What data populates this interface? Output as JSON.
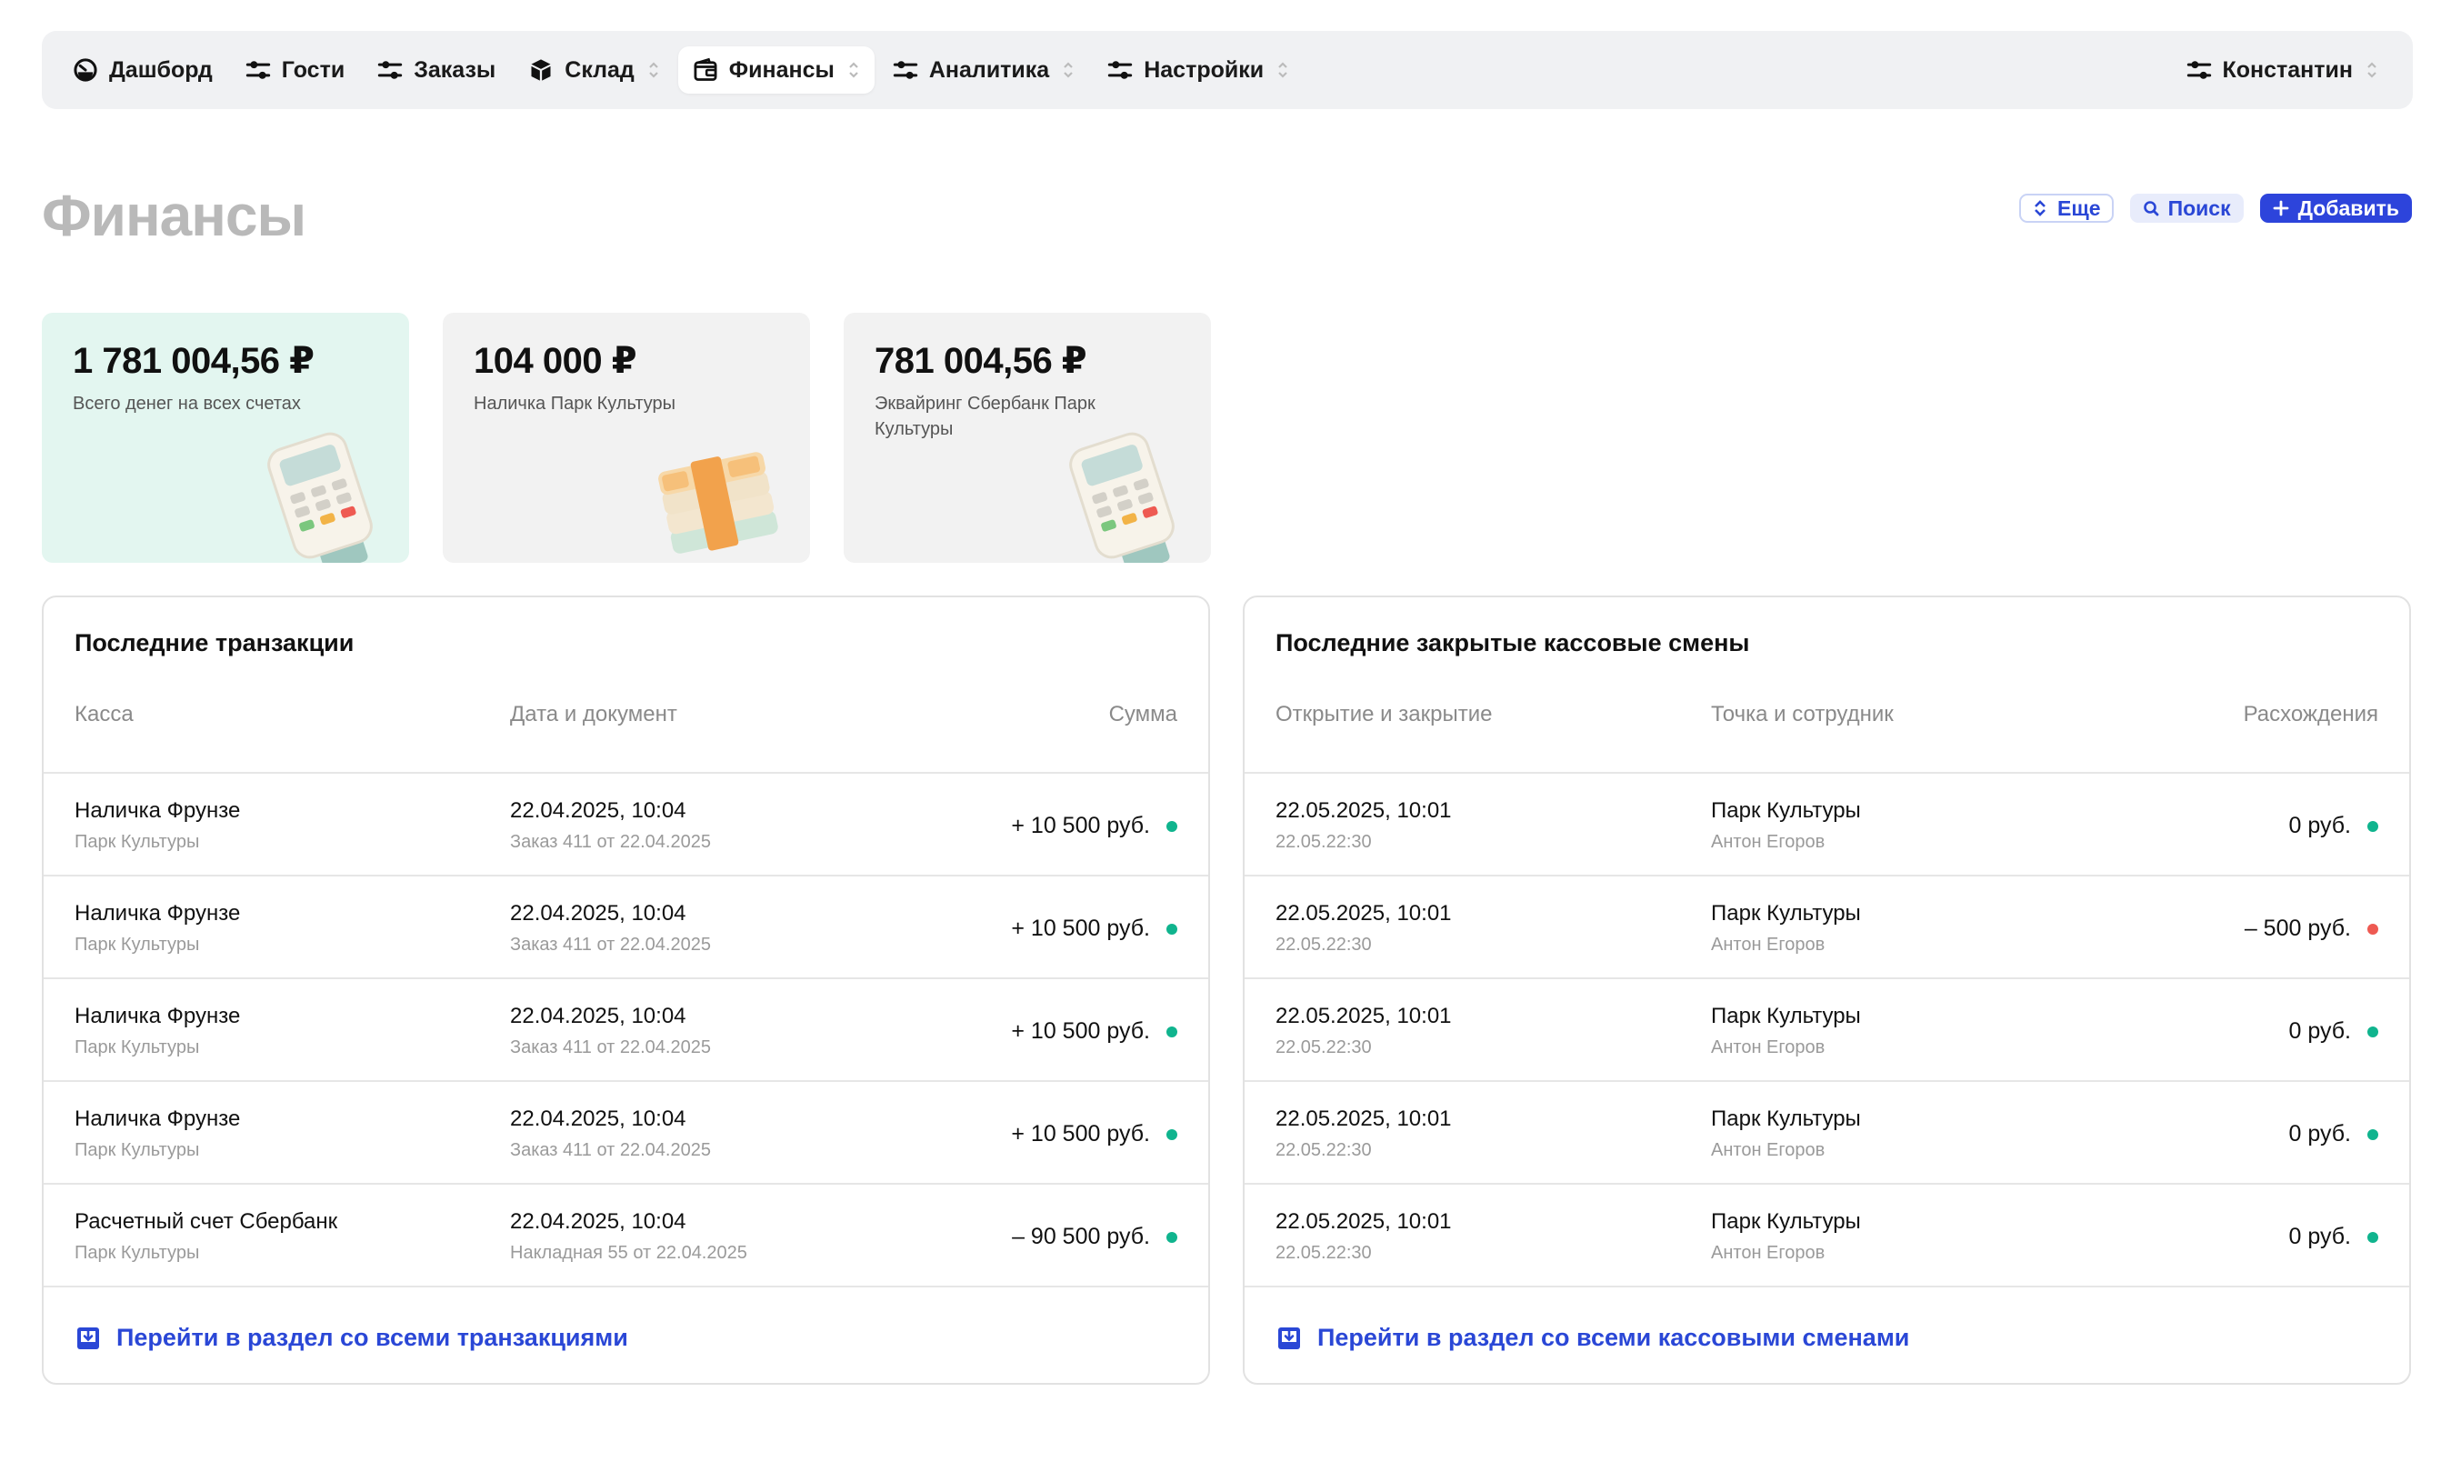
{
  "nav": {
    "items": [
      {
        "label": "Дашборд",
        "icon": "dashboard-icon",
        "has_chevron": false
      },
      {
        "label": "Гости",
        "icon": "sliders-icon",
        "has_chevron": false
      },
      {
        "label": "Заказы",
        "icon": "sliders-icon",
        "has_chevron": false
      },
      {
        "label": "Склад",
        "icon": "box-icon",
        "has_chevron": true
      },
      {
        "label": "Финансы",
        "icon": "wallet-icon",
        "has_chevron": true,
        "active": true
      },
      {
        "label": "Аналитика",
        "icon": "sliders-icon",
        "has_chevron": true
      },
      {
        "label": "Настройки",
        "icon": "sliders-icon",
        "has_chevron": true
      }
    ],
    "user": {
      "label": "Константин",
      "icon": "sliders-icon"
    }
  },
  "page": {
    "title": "Финансы",
    "actions": {
      "more": "Еще",
      "search": "Поиск",
      "add": "Добавить"
    }
  },
  "cards": [
    {
      "amount": "1 781 004,56 ₽",
      "label": "Всего денег на всех счетах",
      "illustration": "card-terminal"
    },
    {
      "amount": "104 000 ₽",
      "label": "Наличка Парк Культуры",
      "illustration": "cash-stack"
    },
    {
      "amount": "781 004,56 ₽",
      "label": "Эквайринг Сбербанк Парк Культуры",
      "illustration": "card-terminal"
    }
  ],
  "transactions": {
    "title": "Последние транзакции",
    "columns": [
      "Касса",
      "Дата и документ",
      "Сумма"
    ],
    "rows": [
      {
        "cash": "Наличка Фрунзе",
        "location": "Парк Культуры",
        "date": "22.04.2025, 10:04",
        "document": "Заказ 411 от 22.04.2025",
        "amount": "+ 10 500 руб.",
        "status": "green"
      },
      {
        "cash": "Наличка Фрунзе",
        "location": "Парк Культуры",
        "date": "22.04.2025, 10:04",
        "document": "Заказ 411 от 22.04.2025",
        "amount": "+ 10 500 руб.",
        "status": "green"
      },
      {
        "cash": "Наличка Фрунзе",
        "location": "Парк Культуры",
        "date": "22.04.2025, 10:04",
        "document": "Заказ 411 от 22.04.2025",
        "amount": "+ 10 500 руб.",
        "status": "green"
      },
      {
        "cash": "Наличка Фрунзе",
        "location": "Парк Культуры",
        "date": "22.04.2025, 10:04",
        "document": "Заказ 411 от 22.04.2025",
        "amount": "+ 10 500 руб.",
        "status": "green"
      },
      {
        "cash": "Расчетный счет Сбербанк",
        "location": "Парк Культуры",
        "date": "22.04.2025, 10:04",
        "document": "Накладная 55 от 22.04.2025",
        "amount": "– 90 500 руб.",
        "status": "green"
      }
    ],
    "footer_link": "Перейти в раздел со всеми транзакциями"
  },
  "shifts": {
    "title": "Последние закрытые кассовые смены",
    "columns": [
      "Открытие и закрытие",
      "Точка и сотрудник",
      "Расхождения"
    ],
    "rows": [
      {
        "opened": "22.05.2025, 10:01",
        "closed": "22.05.22:30",
        "point": "Парк Культуры",
        "employee": "Антон Егоров",
        "diff": "0 руб.",
        "status": "green"
      },
      {
        "opened": "22.05.2025, 10:01",
        "closed": "22.05.22:30",
        "point": "Парк Культуры",
        "employee": "Антон Егоров",
        "diff": "– 500 руб.",
        "status": "red"
      },
      {
        "opened": "22.05.2025, 10:01",
        "closed": "22.05.22:30",
        "point": "Парк Культуры",
        "employee": "Антон Егоров",
        "diff": "0 руб.",
        "status": "green"
      },
      {
        "opened": "22.05.2025, 10:01",
        "closed": "22.05.22:30",
        "point": "Парк Культуры",
        "employee": "Антон Егоров",
        "diff": "0 руб.",
        "status": "green"
      },
      {
        "opened": "22.05.2025, 10:01",
        "closed": "22.05.22:30",
        "point": "Парк Культуры",
        "employee": "Антон Егоров",
        "diff": "0 руб.",
        "status": "green"
      }
    ],
    "footer_link": "Перейти в раздел со всеми кассовыми сменами"
  },
  "colors": {
    "accent": "#2d44db",
    "link": "#2a47d6",
    "positive": "#10b48e",
    "negative": "#ee5a52",
    "card_highlight": "#e3f6f0",
    "card_neutral": "#f2f2f2",
    "nav_bg": "#f0f1f3"
  }
}
